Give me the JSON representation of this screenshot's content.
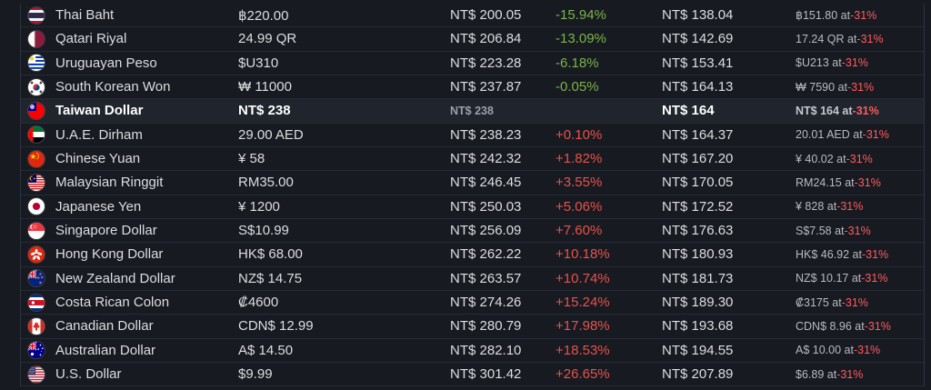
{
  "table": {
    "rows": [
      {
        "flag": "thailand-flag-icon",
        "currency": "Thai Baht",
        "local_price": "฿220.00",
        "converted": "NT$ 200.05",
        "diff": "-15.94%",
        "diff_sign": "neg",
        "sale": "NT$ 138.04",
        "discount_price": "฿151.80 at ",
        "discount_pct": "-31%"
      },
      {
        "flag": "qatar-flag-icon",
        "currency": "Qatari Riyal",
        "local_price": "24.99 QR",
        "converted": "NT$ 206.84",
        "diff": "-13.09%",
        "diff_sign": "neg",
        "sale": "NT$ 142.69",
        "discount_price": "17.24 QR at ",
        "discount_pct": "-31%"
      },
      {
        "flag": "uruguay-flag-icon",
        "currency": "Uruguayan Peso",
        "local_price": "$U310",
        "converted": "NT$ 223.28",
        "diff": "-6.18%",
        "diff_sign": "neg",
        "sale": "NT$ 153.41",
        "discount_price": "$U213 at ",
        "discount_pct": "-31%"
      },
      {
        "flag": "south-korea-flag-icon",
        "currency": "South Korean Won",
        "local_price": "₩ 11000",
        "converted": "NT$ 237.87",
        "diff": "-0.05%",
        "diff_sign": "neg",
        "sale": "NT$ 164.13",
        "discount_price": "₩ 7590 at ",
        "discount_pct": "-31%"
      },
      {
        "flag": "taiwan-flag-icon",
        "currency": "Taiwan Dollar",
        "local_price": "NT$ 238",
        "converted": "NT$ 238",
        "diff": "",
        "diff_sign": "none",
        "sale": "NT$ 164",
        "discount_price": "NT$ 164 at ",
        "discount_pct": "-31%",
        "highlight": true
      },
      {
        "flag": "uae-flag-icon",
        "currency": "U.A.E. Dirham",
        "local_price": "29.00 AED",
        "converted": "NT$ 238.23",
        "diff": "+0.10%",
        "diff_sign": "pos",
        "sale": "NT$ 164.37",
        "discount_price": "20.01 AED at ",
        "discount_pct": "-31%"
      },
      {
        "flag": "china-flag-icon",
        "currency": "Chinese Yuan",
        "local_price": "¥ 58",
        "converted": "NT$ 242.32",
        "diff": "+1.82%",
        "diff_sign": "pos",
        "sale": "NT$ 167.20",
        "discount_price": "¥ 40.02 at ",
        "discount_pct": "-31%"
      },
      {
        "flag": "malaysia-flag-icon",
        "currency": "Malaysian Ringgit",
        "local_price": "RM35.00",
        "converted": "NT$ 246.45",
        "diff": "+3.55%",
        "diff_sign": "pos",
        "sale": "NT$ 170.05",
        "discount_price": "RM24.15 at ",
        "discount_pct": "-31%"
      },
      {
        "flag": "japan-flag-icon",
        "currency": "Japanese Yen",
        "local_price": "¥ 1200",
        "converted": "NT$ 250.03",
        "diff": "+5.06%",
        "diff_sign": "pos",
        "sale": "NT$ 172.52",
        "discount_price": "¥ 828 at ",
        "discount_pct": "-31%"
      },
      {
        "flag": "singapore-flag-icon",
        "currency": "Singapore Dollar",
        "local_price": "S$10.99",
        "converted": "NT$ 256.09",
        "diff": "+7.60%",
        "diff_sign": "pos",
        "sale": "NT$ 176.63",
        "discount_price": "S$7.58 at ",
        "discount_pct": "-31%"
      },
      {
        "flag": "hong-kong-flag-icon",
        "currency": "Hong Kong Dollar",
        "local_price": "HK$ 68.00",
        "converted": "NT$ 262.22",
        "diff": "+10.18%",
        "diff_sign": "pos",
        "sale": "NT$ 180.93",
        "discount_price": "HK$ 46.92 at ",
        "discount_pct": "-31%"
      },
      {
        "flag": "new-zealand-flag-icon",
        "currency": "New Zealand Dollar",
        "local_price": "NZ$ 14.75",
        "converted": "NT$ 263.57",
        "diff": "+10.74%",
        "diff_sign": "pos",
        "sale": "NT$ 181.73",
        "discount_price": "NZ$ 10.17 at ",
        "discount_pct": "-31%"
      },
      {
        "flag": "costa-rica-flag-icon",
        "currency": "Costa Rican Colon",
        "local_price": "₡4600",
        "converted": "NT$ 274.26",
        "diff": "+15.24%",
        "diff_sign": "pos",
        "sale": "NT$ 189.30",
        "discount_price": "₡3175 at ",
        "discount_pct": "-31%"
      },
      {
        "flag": "canada-flag-icon",
        "currency": "Canadian Dollar",
        "local_price": "CDN$ 12.99",
        "converted": "NT$ 280.79",
        "diff": "+17.98%",
        "diff_sign": "pos",
        "sale": "NT$ 193.68",
        "discount_price": "CDN$ 8.96 at ",
        "discount_pct": "-31%"
      },
      {
        "flag": "australia-flag-icon",
        "currency": "Australian Dollar",
        "local_price": "A$ 14.50",
        "converted": "NT$ 282.10",
        "diff": "+18.53%",
        "diff_sign": "pos",
        "sale": "NT$ 194.55",
        "discount_price": "A$ 10.00 at ",
        "discount_pct": "-31%"
      },
      {
        "flag": "usa-flag-icon",
        "currency": "U.S. Dollar",
        "local_price": "$9.99",
        "converted": "NT$ 301.42",
        "diff": "+26.65%",
        "diff_sign": "pos",
        "sale": "NT$ 207.89",
        "discount_price": "$6.89 at ",
        "discount_pct": "-31%"
      }
    ]
  }
}
